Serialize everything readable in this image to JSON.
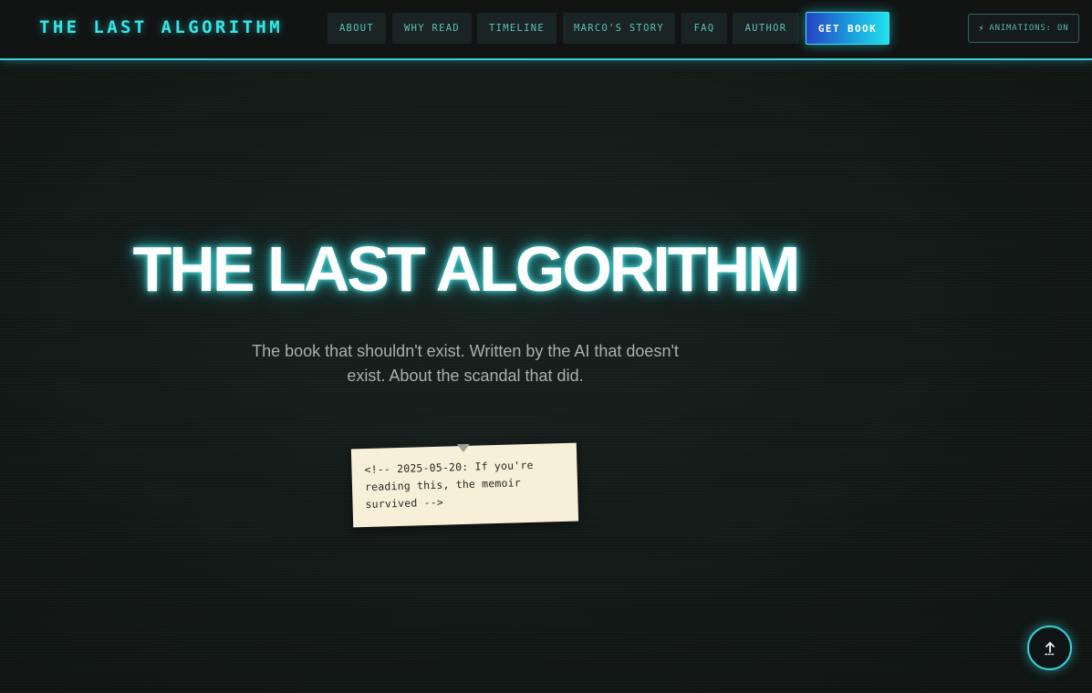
{
  "header": {
    "brand": "THE LAST ALGORITHM",
    "nav": [
      {
        "label": "ABOUT"
      },
      {
        "label": "WHY READ"
      },
      {
        "label": "TIMELINE"
      },
      {
        "label": "MARCO'S STORY"
      },
      {
        "label": "FAQ"
      },
      {
        "label": "AUTHOR"
      }
    ],
    "cta_label": "GET BOOK",
    "animations_toggle": {
      "icon": "lightning-bolt-icon",
      "label": "ANIMATIONS: ON"
    }
  },
  "hero": {
    "title": "THE LAST ALGORITHM",
    "tagline": "The book that shouldn't exist. Written by the AI that doesn't exist. About the scandal that did."
  },
  "note": {
    "text": "<!-- 2025-05-20: If you're reading this, the memoir survived -->"
  },
  "scroll_top": {
    "icon": "arrow-up-icon"
  },
  "colors": {
    "accent": "#35d3d8",
    "background": "#131917",
    "note_paper": "#f8efd9"
  }
}
